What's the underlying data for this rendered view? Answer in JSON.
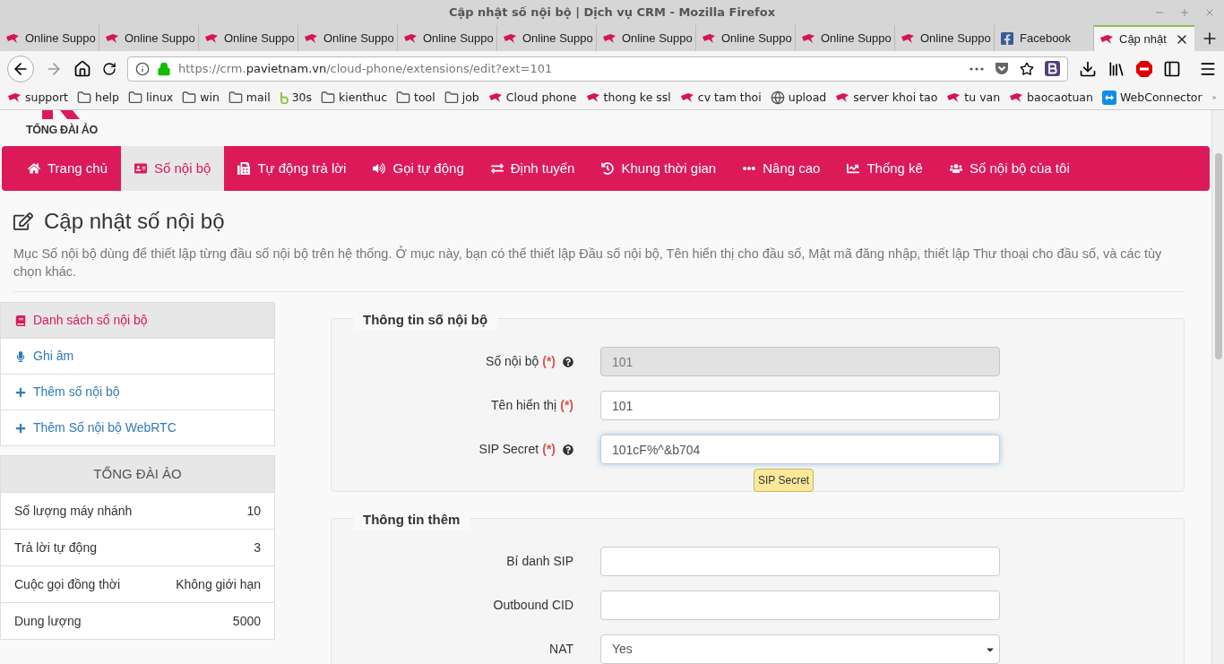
{
  "window": {
    "title": "Cập nhật số nội bộ | Dịch vụ CRM - Mozilla Firefox"
  },
  "tabs": [
    {
      "label": "Online Suppo",
      "selected": false,
      "kind": "site"
    },
    {
      "label": "Online Suppo",
      "selected": false,
      "kind": "site"
    },
    {
      "label": "Online Suppo",
      "selected": false,
      "kind": "site"
    },
    {
      "label": "Online Suppo",
      "selected": false,
      "kind": "site"
    },
    {
      "label": "Online Suppo",
      "selected": false,
      "kind": "site"
    },
    {
      "label": "Online Suppo",
      "selected": false,
      "kind": "site"
    },
    {
      "label": "Online Suppo",
      "selected": false,
      "kind": "site"
    },
    {
      "label": "Online Suppo",
      "selected": false,
      "kind": "site"
    },
    {
      "label": "Online Suppo",
      "selected": false,
      "kind": "site"
    },
    {
      "label": "Online Suppo",
      "selected": false,
      "kind": "site"
    },
    {
      "label": "Facebook",
      "selected": false,
      "kind": "facebook"
    },
    {
      "label": "Cập nhật",
      "selected": true,
      "kind": "site"
    }
  ],
  "address": {
    "scheme": "https://crm.",
    "domain": "pavietnam.vn",
    "path": "/cloud-phone/extensions/edit?ext=101"
  },
  "bookmarks": [
    {
      "label": "support",
      "kind": "site"
    },
    {
      "label": "help",
      "kind": "folder"
    },
    {
      "label": "linux",
      "kind": "folder"
    },
    {
      "label": "win",
      "kind": "folder"
    },
    {
      "label": "mail",
      "kind": "folder"
    },
    {
      "label": "30s",
      "kind": "b"
    },
    {
      "label": "kienthuc",
      "kind": "folder"
    },
    {
      "label": "tool",
      "kind": "folder"
    },
    {
      "label": "job",
      "kind": "folder"
    },
    {
      "label": "Cloud phone",
      "kind": "site"
    },
    {
      "label": "thong ke ssl",
      "kind": "site"
    },
    {
      "label": "cv tam thoi",
      "kind": "site"
    },
    {
      "label": "upload",
      "kind": "globe"
    },
    {
      "label": "server khoi tao",
      "kind": "site"
    },
    {
      "label": "tu van",
      "kind": "site"
    },
    {
      "label": "baocaotuan",
      "kind": "site"
    },
    {
      "label": "WebConnector",
      "kind": "connector"
    }
  ],
  "logo": {
    "text": "TỔNG ĐÀI ẢO"
  },
  "nav": [
    {
      "label": "Trang chủ",
      "selected": false
    },
    {
      "label": "Số nội bộ",
      "selected": true
    },
    {
      "label": "Tự động trả lời",
      "selected": false
    },
    {
      "label": "Gọi tự động",
      "selected": false
    },
    {
      "label": "Định tuyến",
      "selected": false
    },
    {
      "label": "Khung thời gian",
      "selected": false
    },
    {
      "label": "Nâng cao",
      "selected": false
    },
    {
      "label": "Thống kê",
      "selected": false
    },
    {
      "label": "Số nội bộ của tôi",
      "selected": false
    }
  ],
  "page": {
    "heading": "Cập nhật số nội bộ",
    "description": "Mục Số nội bộ dùng để thiết lập từng đầu số nội bộ trên hệ thống. Ở mục này, bạn có thể thiết lập Đầu số nội bộ, Tên hiển thị cho đầu số, Mật mã đăng nhập, thiết lập Thư thoại cho đầu số, và các tùy chọn khác."
  },
  "sidebar": {
    "items": [
      {
        "label": "Danh sách số nội bộ",
        "selected": true
      },
      {
        "label": "Ghi âm",
        "selected": false
      },
      {
        "label": "Thêm số nội bộ",
        "selected": false
      },
      {
        "label": "Thêm Số nội bộ WebRTC",
        "selected": false
      }
    ],
    "stats_title": "TỔNG ĐÀI ẢO",
    "stats": [
      {
        "label": "Số lượng máy nhánh",
        "value": "10"
      },
      {
        "label": "Trả lời tự động",
        "value": "3"
      },
      {
        "label": "Cuộc gọi đồng thời",
        "value": "Không giới hạn"
      },
      {
        "label": "Dung lượng",
        "value": "5000"
      }
    ]
  },
  "fieldsets": [
    {
      "legend": "Thông tin số nội bộ",
      "fields": [
        {
          "kind": "input",
          "label": "Số nội bộ",
          "required_mark": "(*)",
          "help": true,
          "value": "101",
          "disabled": true,
          "focused": false
        },
        {
          "kind": "input",
          "label": "Tên hiển thị",
          "required_mark": "(*)",
          "help": false,
          "value": "101",
          "disabled": false,
          "focused": false
        },
        {
          "kind": "input",
          "label": "SIP Secret",
          "required_mark": "(*)",
          "help": true,
          "value": "101cF%^&b704",
          "disabled": false,
          "focused": true,
          "tooltip": "SIP Secret"
        }
      ]
    },
    {
      "legend": "Thông tin thêm",
      "fields": [
        {
          "kind": "input",
          "label": "Bí danh SIP",
          "help": false,
          "disabled": false,
          "focused": false
        },
        {
          "kind": "input",
          "label": "Outbound CID",
          "help": false,
          "disabled": false,
          "focused": false
        },
        {
          "kind": "select",
          "label": "NAT",
          "help": false,
          "value": "Yes",
          "disabled": false,
          "focused": false
        }
      ]
    }
  ]
}
